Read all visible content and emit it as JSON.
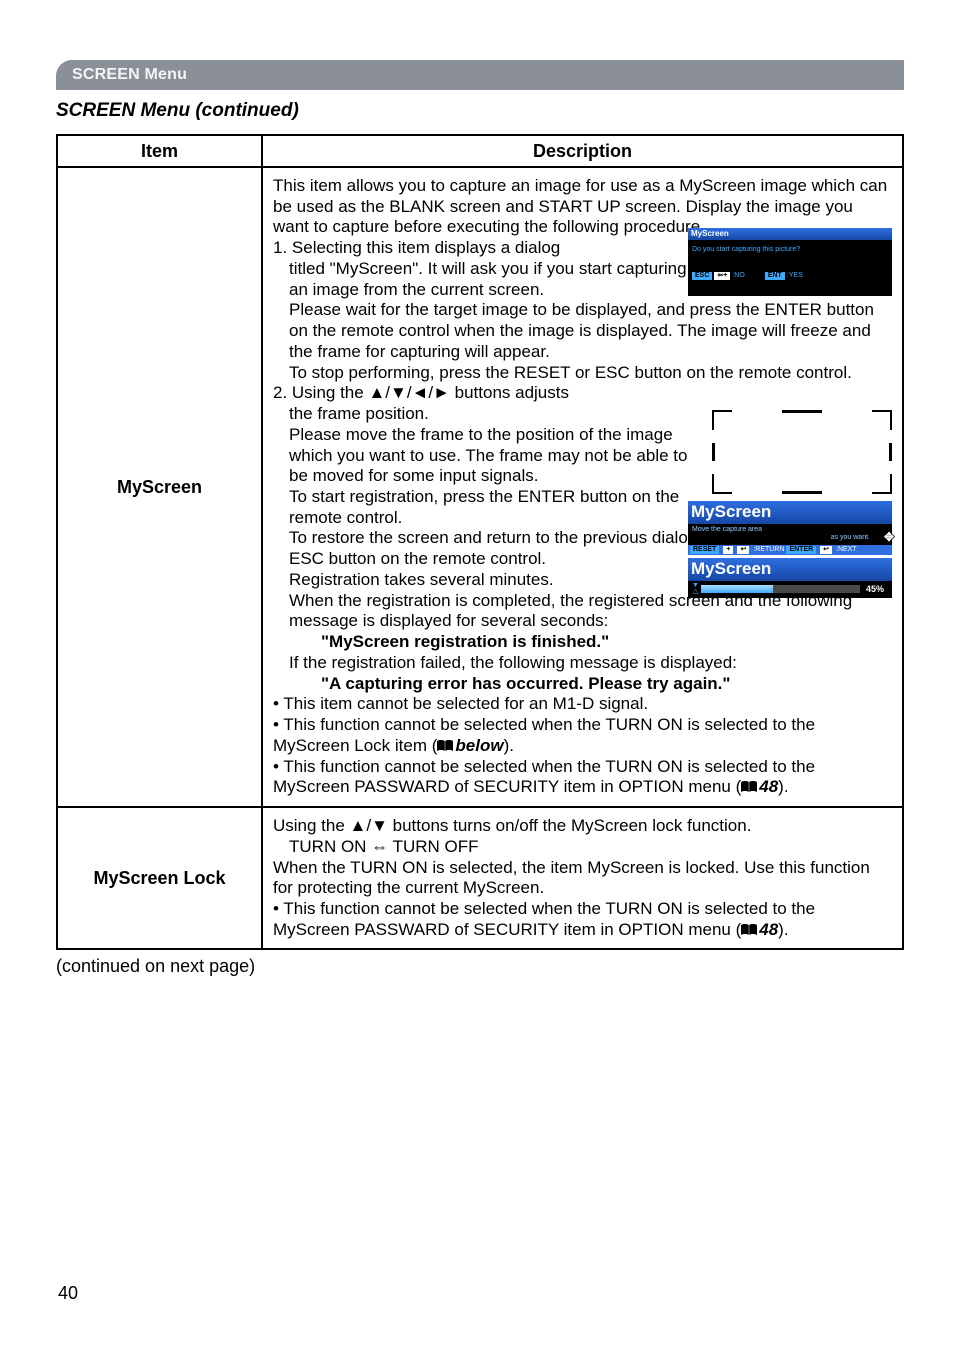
{
  "header": {
    "menu_title": "SCREEN Menu"
  },
  "section_title": "SCREEN Menu (continued)",
  "table": {
    "col_item": "Item",
    "col_desc": "Description"
  },
  "myscreen": {
    "name": "MyScreen",
    "d_intro": "This item allows you to capture an image for use as a MyScreen image which can be used as the BLANK screen and START UP screen. Display the image you want to capture before executing the following procedure.",
    "d_step1a": "1. Selecting this item displays a dialog",
    "d_step1b": "titled \"MyScreen\". It will ask you if you start capturing an image from the current screen.",
    "d_step1c": "Please wait for the target image to be displayed, and press the ENTER button on the remote control when the image is displayed. The image will freeze and the frame for capturing will appear.",
    "d_step1d": "To stop performing, press the RESET or ESC button on the remote control.",
    "d_step2a": "2. Using the ▲/▼/◄/► buttons adjusts",
    "d_step2b": "the frame position.",
    "d_step2c": "Please move the frame to the position of the image which you want to use. The frame may not be able to be moved for some input signals.",
    "d_step2d": "To start registration, press the ENTER button on the remote control.",
    "d_step2e": "To restore the screen and return to the previous dialog, press the RESET or ESC button on the remote control.",
    "d_reg": "Registration takes several minutes.",
    "d_reg2": "When the registration is completed, the registered screen and the following message is displayed for several seconds:",
    "d_msg_ok": "\"MyScreen registration is finished.\"",
    "d_reg3": "If the registration failed, the following message is displayed:",
    "d_msg_fail": "\"A capturing error has occurred. Please try again.\"",
    "d_bul1": "• This item cannot be selected for an M1-D signal.",
    "d_bul2a": "• This function cannot be selected when the TURN ON is selected to the MyScreen Lock item (",
    "d_bul2b": "below",
    "d_bul2c": ").",
    "d_bul3a": "• This function cannot be selected when the TURN ON is selected to the MyScreen PASSWARD of SECURITY item in OPTION menu (",
    "d_bul3b": "48",
    "d_bul3c": ")."
  },
  "lock": {
    "name": "MyScreen Lock",
    "l1": "Using the ▲/▼ buttons turns on/off the MyScreen lock function.",
    "l2": "TURN ON ⇔ TURN OFF",
    "l3": "When the TURN ON is selected, the item MyScreen is locked. Use this function for protecting the current MyScreen.",
    "l4a": "• This function cannot be selected when the TURN ON is selected to the MyScreen PASSWARD of SECURITY item in OPTION menu (",
    "l4b": "48",
    "l4c": ")."
  },
  "osd": {
    "title": "MyScreen",
    "confirm": "Do you start capturing this picture?",
    "esc": "ESC",
    "esc_icon": "⇐+",
    "no": ":NO",
    "ent": "ENT",
    "yes": ":YES",
    "move_title": "MyScreen",
    "move_l1": "Move the capture area",
    "move_l2": "as you want.",
    "chips": {
      "reset": "RESET",
      "plus": "+",
      "ret_icon": "↩",
      "return": ":RETURN",
      "enter": "ENTER",
      "ret_icon2": "↩",
      "next": ":NEXT"
    },
    "prog_title": "MyScreen",
    "progress_pct": "45%"
  },
  "continued": "(continued on next page)",
  "page_number": "40"
}
